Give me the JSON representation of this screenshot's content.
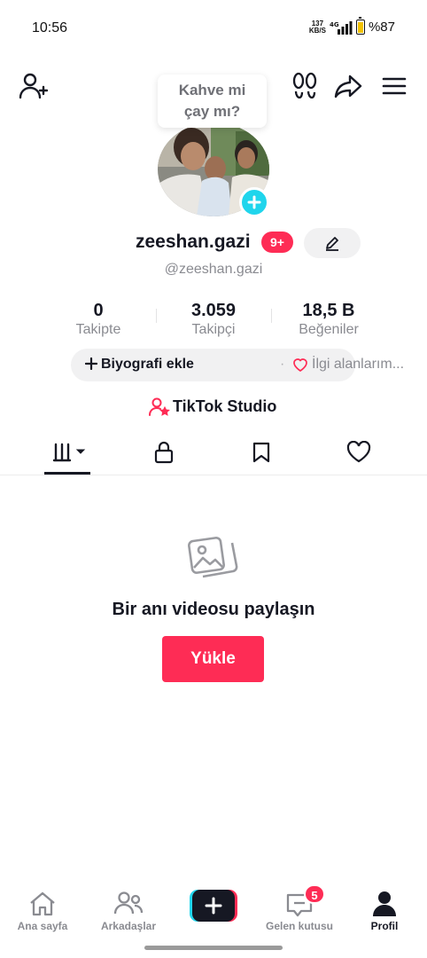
{
  "status_bar": {
    "time": "10:56",
    "net_speed_value": "137",
    "net_speed_unit": "KB/S",
    "network": "4G",
    "battery": "%87"
  },
  "tooltip": {
    "line1": "Kahve mi",
    "line2": "çay mı?"
  },
  "profile": {
    "username": "zeeshan.gazi",
    "notification_badge": "9+",
    "handle": "@zeeshan.gazi"
  },
  "stats": [
    {
      "value": "0",
      "label": "Takipte"
    },
    {
      "value": "3.059",
      "label": "Takipçi"
    },
    {
      "value": "18,5 B",
      "label": "Beğeniler"
    }
  ],
  "bio": {
    "add_label": "Biyografi ekle",
    "separator": "·",
    "interests_label": "İlgi alanlarım..."
  },
  "studio": {
    "label": "TikTok Studio"
  },
  "tabs": [
    {
      "icon": "grid-icon",
      "active": true
    },
    {
      "icon": "lock-icon",
      "active": false
    },
    {
      "icon": "bookmark-icon",
      "active": false
    },
    {
      "icon": "heart-icon",
      "active": false
    }
  ],
  "empty_state": {
    "icon": "photo-stack-icon",
    "title": "Bir anı videosu paylaşın",
    "button": "Yükle"
  },
  "bottom_nav": {
    "home": "Ana sayfa",
    "friends": "Arkadaşlar",
    "inbox": "Gelen kutusu",
    "inbox_badge": "5",
    "profile": "Profil"
  },
  "colors": {
    "accent": "#fe2c55",
    "cyan": "#20d5ec",
    "text": "#161823",
    "muted": "#8a8b91"
  }
}
